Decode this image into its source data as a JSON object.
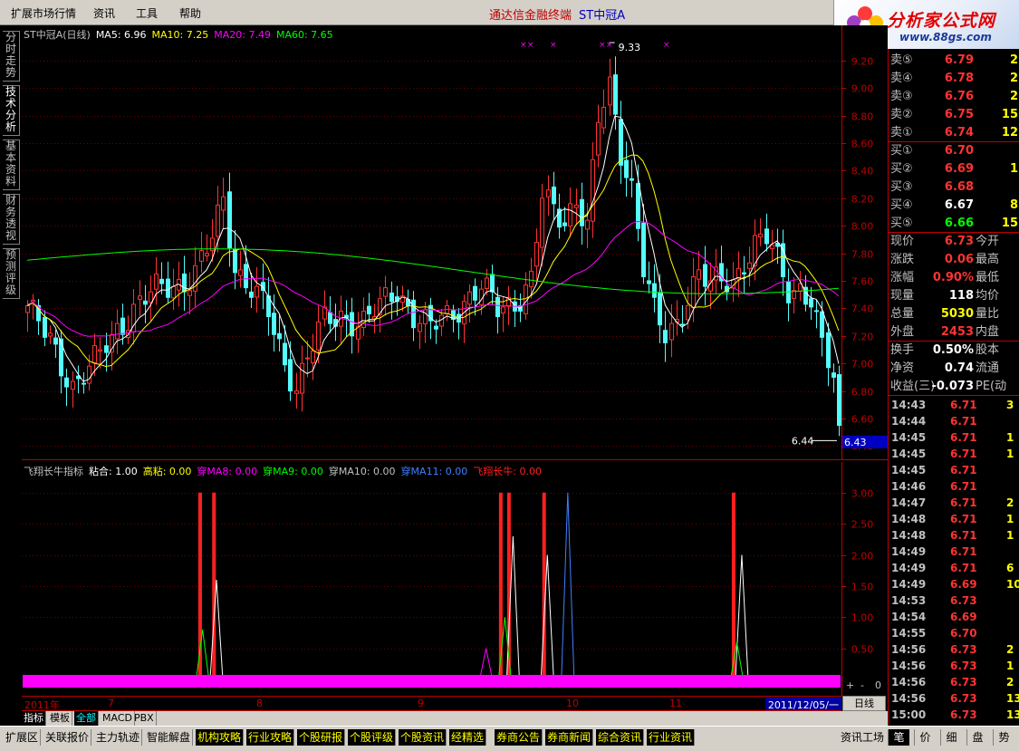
{
  "menu": [
    "扩展市场行情",
    "资讯",
    "工具",
    "帮助"
  ],
  "app_title": "通达信金融终端",
  "stock_name": "ST中冠A",
  "logo": {
    "text": "分析家公式网",
    "url": "www.88gs.com"
  },
  "left_tabs": [
    "分时走势",
    "技术分析",
    "基本资料",
    "财务透视",
    "预测评级"
  ],
  "main_legend": [
    {
      "label": "ST中冠A(日线)",
      "color": "#c0c0c0"
    },
    {
      "label": "MA5: 6.96",
      "color": "#ffffff"
    },
    {
      "label": "MA10: 7.25",
      "color": "#ffff00"
    },
    {
      "label": "MA20: 7.49",
      "color": "#ff00ff"
    },
    {
      "label": "MA60: 7.65",
      "color": "#00ff00"
    }
  ],
  "sub_legend": [
    {
      "label": "飞翔长牛指标",
      "color": "#c0c0c0"
    },
    {
      "label": "粘合: 1.00",
      "color": "#ffffff"
    },
    {
      "label": "高粘: 0.00",
      "color": "#ffff00"
    },
    {
      "label": "穿MA8: 0.00",
      "color": "#ff00ff"
    },
    {
      "label": "穿MA9: 0.00",
      "color": "#00ff00"
    },
    {
      "label": "穿MA10: 0.00",
      "color": "#c0c0c0"
    },
    {
      "label": "穿MA11: 0.00",
      "color": "#4080ff"
    },
    {
      "label": "飞翔长牛: 0.00",
      "color": "#ff2020"
    }
  ],
  "chart_data": [
    {
      "type": "candlestick",
      "title": "ST中冠A(日线)",
      "ylim": [
        6.35,
        9.35
      ],
      "y_ticks": [
        "9.20",
        "9.00",
        "8.80",
        "8.60",
        "8.40",
        "8.20",
        "8.00",
        "7.80",
        "7.60",
        "7.40",
        "7.20",
        "7.00",
        "6.80",
        "6.60",
        "6.40"
      ],
      "annotations": [
        {
          "label": "9.33",
          "value": 9.33
        },
        {
          "label": "6.44",
          "value": 6.44
        }
      ],
      "current_price_label": "6.43",
      "current_price": 6.43,
      "x_labels": [
        "2011年",
        "7",
        "8",
        "9",
        "10",
        "11"
      ],
      "current_date": "2011/12/05/一",
      "period": "日线",
      "ma_colors": {
        "MA5": "#ffffff",
        "MA10": "#ffff00",
        "MA20": "#ff00ff",
        "MA60": "#00ff00"
      }
    },
    {
      "type": "line",
      "title": "飞翔长牛指标",
      "ylim": [
        0,
        3.2
      ],
      "y_ticks": [
        "3.00",
        "2.50",
        "2.00",
        "1.50",
        "1.00",
        "0.50"
      ],
      "series": [
        {
          "name": "粘合",
          "color": "#ffffff",
          "values_note": ""
        },
        {
          "name": "飞翔长牛",
          "color": "#ff2020"
        }
      ],
      "spikes": [
        {
          "series": "飞翔长牛",
          "pos": 0.215,
          "value": 3.0
        },
        {
          "series": "飞翔长牛",
          "pos": 0.232,
          "value": 3.0
        },
        {
          "series": "粘合",
          "pos": 0.235,
          "value": 1.6
        },
        {
          "series": "穿MA9",
          "pos": 0.218,
          "value": 0.8
        },
        {
          "series": "穿MA8",
          "pos": 0.565,
          "value": 0.5
        },
        {
          "series": "飞翔长牛",
          "pos": 0.583,
          "value": 3.0
        },
        {
          "series": "飞翔长牛",
          "pos": 0.593,
          "value": 3.0
        },
        {
          "series": "粘合",
          "pos": 0.598,
          "value": 2.3
        },
        {
          "series": "穿MA9",
          "pos": 0.588,
          "value": 1.0
        },
        {
          "series": "飞翔长牛",
          "pos": 0.636,
          "value": 3.0
        },
        {
          "series": "粘合",
          "pos": 0.64,
          "value": 2.0
        },
        {
          "series": "穿MA11",
          "pos": 0.665,
          "value": 3.0
        },
        {
          "series": "飞翔长牛",
          "pos": 0.868,
          "value": 3.0
        },
        {
          "series": "粘合",
          "pos": 0.878,
          "value": 2.0
        },
        {
          "series": "穿MA9",
          "pos": 0.872,
          "value": 0.6
        }
      ],
      "baseline_value": 0
    }
  ],
  "quote": {
    "asks": [
      {
        "label": "卖⑤",
        "price": "6.79",
        "vol": "2"
      },
      {
        "label": "卖④",
        "price": "6.78",
        "vol": "2"
      },
      {
        "label": "卖③",
        "price": "6.76",
        "vol": "2"
      },
      {
        "label": "卖②",
        "price": "6.75",
        "vol": "15"
      },
      {
        "label": "卖①",
        "price": "6.74",
        "vol": "12"
      }
    ],
    "bids": [
      {
        "label": "买①",
        "price": "6.70",
        "vol": ""
      },
      {
        "label": "买②",
        "price": "6.69",
        "vol": "1"
      },
      {
        "label": "买③",
        "price": "6.68",
        "vol": ""
      },
      {
        "label": "买④",
        "price": "6.67",
        "vol": "8"
      },
      {
        "label": "买⑤",
        "price": "6.66",
        "vol": "15"
      }
    ],
    "stats": [
      {
        "label": "现价",
        "value": "6.73",
        "right": "今开"
      },
      {
        "label": "涨跌",
        "value": "0.06",
        "right": "最高"
      },
      {
        "label": "涨幅",
        "value": "0.90%",
        "right": "最低"
      },
      {
        "label": "现量",
        "value": "118",
        "right": "均价"
      },
      {
        "label": "总量",
        "value": "5030",
        "right": "量比"
      },
      {
        "label": "外盘",
        "value": "2453",
        "right": "内盘"
      }
    ],
    "stats2": [
      {
        "label": "换手",
        "value": "0.50%",
        "right": "股本"
      },
      {
        "label": "净资",
        "value": "0.74",
        "right": "流通"
      },
      {
        "label": "收益(三)",
        "value": "-0.073",
        "right": "PE(动"
      }
    ],
    "ticks": [
      {
        "time": "14:43",
        "price": "6.71",
        "vol": "3"
      },
      {
        "time": "14:44",
        "price": "6.71",
        "vol": ""
      },
      {
        "time": "14:45",
        "price": "6.71",
        "vol": "1"
      },
      {
        "time": "14:45",
        "price": "6.71",
        "vol": "1"
      },
      {
        "time": "14:45",
        "price": "6.71",
        "vol": ""
      },
      {
        "time": "14:46",
        "price": "6.71",
        "vol": ""
      },
      {
        "time": "14:47",
        "price": "6.71",
        "vol": "2"
      },
      {
        "time": "14:48",
        "price": "6.71",
        "vol": "1"
      },
      {
        "time": "14:48",
        "price": "6.71",
        "vol": "1"
      },
      {
        "time": "14:49",
        "price": "6.71",
        "vol": ""
      },
      {
        "time": "14:49",
        "price": "6.71",
        "vol": "6"
      },
      {
        "time": "14:49",
        "price": "6.69",
        "vol": "10"
      },
      {
        "time": "14:53",
        "price": "6.73",
        "vol": ""
      },
      {
        "time": "14:54",
        "price": "6.69",
        "vol": ""
      },
      {
        "time": "14:55",
        "price": "6.70",
        "vol": ""
      },
      {
        "time": "14:56",
        "price": "6.73",
        "vol": "2"
      },
      {
        "time": "14:56",
        "price": "6.73",
        "vol": "1"
      },
      {
        "time": "14:56",
        "price": "6.73",
        "vol": "2"
      },
      {
        "time": "14:56",
        "price": "6.73",
        "vol": "13"
      },
      {
        "time": "15:00",
        "price": "6.73",
        "vol": "13"
      }
    ]
  },
  "zoom_buttons": [
    "+",
    "-",
    "0"
  ],
  "sub_tabs": [
    {
      "label": "指标",
      "style": "on"
    },
    {
      "label": "模板",
      "style": ""
    },
    {
      "label": "全部",
      "style": "cyan"
    },
    {
      "label": "MACD",
      "style": ""
    },
    {
      "label": "PBX",
      "style": ""
    }
  ],
  "bottom_tabs": [
    {
      "label": "扩展区",
      "hl": false
    },
    {
      "label": "关联报价",
      "hl": false
    },
    {
      "label": "主力轨迹",
      "hl": false
    },
    {
      "label": "智能解盘",
      "hl": false
    },
    {
      "label": "机构攻略",
      "hl": true
    },
    {
      "label": "行业攻略",
      "hl": true
    },
    {
      "label": "个股研报",
      "hl": true
    },
    {
      "label": "个股评级",
      "hl": true
    },
    {
      "label": "个股资讯",
      "hl": true
    },
    {
      "label": "经精选",
      "hl": true
    },
    {
      "label": "券商公告",
      "hl": true
    },
    {
      "label": "券商新闻",
      "hl": true
    },
    {
      "label": "综合资讯",
      "hl": true
    },
    {
      "label": "行业资讯",
      "hl": true
    }
  ],
  "bottom_info": "资讯工场",
  "right_buttons": [
    "笔",
    "价",
    "细",
    "盘",
    "势"
  ]
}
